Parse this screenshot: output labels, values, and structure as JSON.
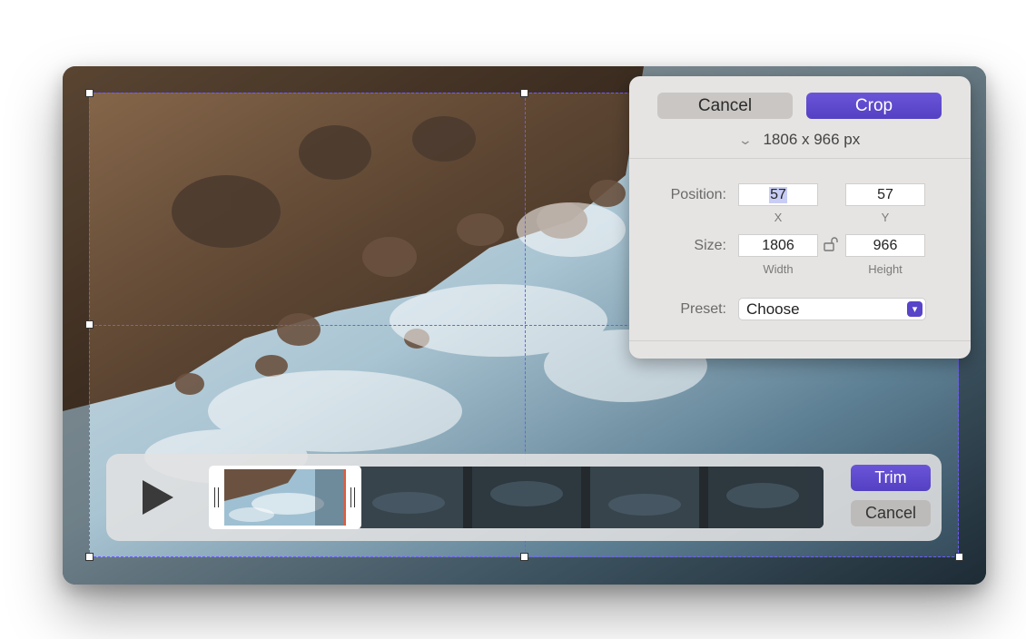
{
  "panel": {
    "cancel_label": "Cancel",
    "crop_label": "Crop",
    "dimensions": "1806 x  966 px",
    "position_label": "Position:",
    "size_label": "Size:",
    "preset_label": "Preset:",
    "x_value": "57",
    "y_value": "57",
    "x_caption": "X",
    "y_caption": "Y",
    "width_value": "1806",
    "height_value": "966",
    "width_caption": "Width",
    "height_caption": "Height",
    "preset_value": "Choose"
  },
  "trim": {
    "trim_label": "Trim",
    "cancel_label": "Cancel"
  },
  "colors": {
    "accent": "#5a46c9",
    "guide": "#6f5cff",
    "panel_bg": "#e6e4e2"
  },
  "icons": {
    "dims_toggle": "chevron-down-icon",
    "aspect_lock": "unlock-icon",
    "play": "play-icon",
    "preset_dropdown": "chevron-down-icon"
  }
}
